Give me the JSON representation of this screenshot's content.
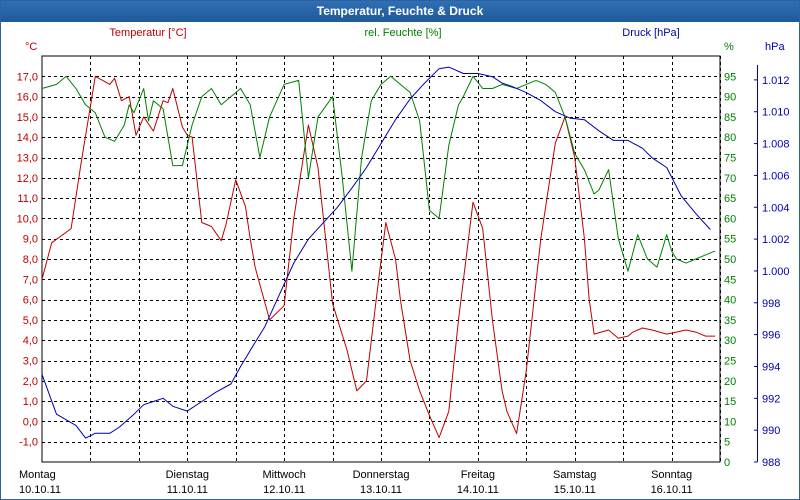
{
  "window": {
    "title": "Temperatur, Feuchte & Druck"
  },
  "chart_data": {
    "type": "line",
    "title": "Temperatur, Feuchte & Druck",
    "colors": {
      "temperature": "#c00000",
      "humidity": "#008000",
      "pressure": "#0000b0",
      "title_bar": "#1f5a9a"
    },
    "x_axis": {
      "range": [
        0,
        7
      ],
      "days": [
        {
          "weekday": "Montag",
          "date": "10.10.11"
        },
        {
          "weekday": "Dienstag",
          "date": "11.10.11"
        },
        {
          "weekday": "Mittwoch",
          "date": "12.10.11"
        },
        {
          "weekday": "Donnerstag",
          "date": "13.10.11"
        },
        {
          "weekday": "Freitag",
          "date": "14.10.11"
        },
        {
          "weekday": "Samstag",
          "date": "15.10.11"
        },
        {
          "weekday": "Sonntag",
          "date": "16.10.11"
        }
      ]
    },
    "left_axis": {
      "label": "Temperatur [°C]",
      "unit": "°C",
      "range": [
        -2,
        18
      ],
      "ticks": [
        "-1,0",
        "0,0",
        "1,0",
        "2,0",
        "3,0",
        "4,0",
        "5,0",
        "6,0",
        "7,0",
        "8,0",
        "9,0",
        "10,0",
        "11,0",
        "12,0",
        "13,0",
        "14,0",
        "15,0",
        "16,0",
        "17,0"
      ]
    },
    "mid_axis": {
      "label": "rel. Feuchte [%]",
      "unit": "%",
      "range": [
        0,
        100
      ],
      "ticks": [
        "0",
        "5",
        "10",
        "15",
        "20",
        "25",
        "30",
        "35",
        "40",
        "45",
        "50",
        "55",
        "60",
        "65",
        "70",
        "75",
        "80",
        "85",
        "90",
        "95"
      ]
    },
    "right_axis": {
      "label": "Druck [hPa]",
      "unit": "hPa",
      "range": [
        988,
        1013.5
      ],
      "ticks": [
        "988",
        "990",
        "992",
        "994",
        "996",
        "998",
        "1.000",
        "1.002",
        "1.004",
        "1.006",
        "1.008",
        "1.010",
        "1.012"
      ]
    },
    "grid": true,
    "series": [
      {
        "name": "Temperatur [°C]",
        "axis": "left",
        "x": [
          0,
          0.1,
          0.3,
          0.4,
          0.55,
          0.7,
          0.75,
          0.82,
          0.9,
          0.97,
          1.05,
          1.15,
          1.25,
          1.3,
          1.35,
          1.45,
          1.5,
          1.55,
          1.65,
          1.75,
          1.85,
          1.9,
          2.0,
          2.1,
          2.15,
          2.2,
          2.35,
          2.5,
          2.6,
          2.75,
          2.85,
          3.0,
          3.15,
          3.25,
          3.35,
          3.45,
          3.55,
          3.65,
          3.7,
          3.75,
          3.8,
          3.9,
          4.0,
          4.1,
          4.2,
          4.3,
          4.45,
          4.55,
          4.65,
          4.75,
          4.8,
          4.9,
          5.0,
          5.15,
          5.3,
          5.4,
          5.5,
          5.6,
          5.65,
          5.7,
          5.85,
          5.95,
          6.05,
          6.1,
          6.2,
          6.3,
          6.45,
          6.55,
          6.65,
          6.75,
          6.8,
          6.85,
          6.95
        ],
        "values": [
          7.0,
          8.8,
          9.5,
          12.6,
          17.0,
          16.6,
          16.9,
          15.8,
          16.0,
          14.1,
          15.0,
          14.3,
          15.8,
          15.7,
          16.4,
          14.5,
          14.1,
          14.0,
          9.8,
          9.6,
          8.9,
          9.7,
          11.9,
          10.6,
          9.0,
          7.6,
          5.0,
          5.7,
          10.0,
          14.6,
          12.5,
          5.8,
          3.5,
          1.5,
          2.0,
          6.0,
          9.8,
          8.0,
          6.0,
          4.5,
          3.0,
          1.5,
          0.3,
          -0.8,
          0.5,
          5.0,
          10.8,
          9.5,
          5.0,
          1.5,
          0.5,
          -0.6,
          2.5,
          9.0,
          13.7,
          15.0,
          13.0,
          9.0,
          6.0,
          4.3,
          4.5,
          4.1,
          4.2,
          4.4,
          4.6,
          4.5,
          4.3,
          4.4,
          4.5,
          4.4,
          4.3,
          4.2,
          4.2
        ]
      },
      {
        "name": "rel. Feuchte [%]",
        "axis": "mid",
        "x": [
          0,
          0.15,
          0.25,
          0.35,
          0.45,
          0.55,
          0.65,
          0.75,
          0.85,
          0.9,
          0.95,
          1.05,
          1.1,
          1.15,
          1.25,
          1.35,
          1.45,
          1.55,
          1.65,
          1.75,
          1.85,
          1.95,
          2.05,
          2.15,
          2.25,
          2.35,
          2.5,
          2.65,
          2.75,
          2.85,
          3.0,
          3.1,
          3.2,
          3.3,
          3.4,
          3.5,
          3.6,
          3.7,
          3.8,
          3.9,
          4.0,
          4.1,
          4.2,
          4.3,
          4.35,
          4.45,
          4.55,
          4.65,
          4.75,
          4.9,
          5.0,
          5.1,
          5.2,
          5.3,
          5.4,
          5.5,
          5.6,
          5.7,
          5.75,
          5.85,
          5.95,
          6.05,
          6.15,
          6.25,
          6.35,
          6.45,
          6.5,
          6.55,
          6.65,
          6.75,
          6.85,
          6.95
        ],
        "values": [
          92,
          93,
          95,
          92,
          88,
          86,
          80,
          79,
          83,
          88,
          86,
          92,
          84,
          89,
          87,
          73,
          73,
          83,
          90,
          92,
          88,
          90,
          92,
          88,
          75,
          85,
          93,
          94,
          70,
          85,
          90,
          70,
          47,
          75,
          89,
          93,
          95,
          93,
          91,
          84,
          62,
          60,
          78,
          88,
          90,
          95,
          92,
          92,
          93,
          92,
          93,
          94,
          93,
          91,
          85,
          76,
          72,
          66,
          67,
          72,
          55,
          47,
          56,
          50,
          48,
          56,
          52,
          50,
          49,
          50,
          51,
          52
        ]
      },
      {
        "name": "Druck [hPa]",
        "axis": "right",
        "x": [
          0,
          0.15,
          0.35,
          0.45,
          0.55,
          0.7,
          0.8,
          0.95,
          1.05,
          1.15,
          1.25,
          1.35,
          1.5,
          1.65,
          1.8,
          1.95,
          2.05,
          2.15,
          2.3,
          2.45,
          2.6,
          2.75,
          2.9,
          3.05,
          3.2,
          3.35,
          3.5,
          3.65,
          3.8,
          3.95,
          4.1,
          4.2,
          4.35,
          4.5,
          4.65,
          4.75,
          4.85,
          5.0,
          5.15,
          5.3,
          5.45,
          5.6,
          5.75,
          5.9,
          6.05,
          6.2,
          6.3,
          6.45,
          6.6,
          6.75,
          6.9
        ],
        "values": [
          993.5,
          991.0,
          990.3,
          989.5,
          989.8,
          989.8,
          990.2,
          991.0,
          991.6,
          991.8,
          992.0,
          991.5,
          991.2,
          991.8,
          992.4,
          992.9,
          994.0,
          995.0,
          996.5,
          998.5,
          1000.5,
          1002.0,
          1003.0,
          1004.0,
          1005.2,
          1006.5,
          1008.0,
          1009.5,
          1010.8,
          1011.8,
          1012.7,
          1012.8,
          1012.4,
          1012.4,
          1012.2,
          1011.8,
          1011.6,
          1011.2,
          1010.7,
          1010.0,
          1009.6,
          1009.5,
          1008.8,
          1008.2,
          1008.2,
          1007.7,
          1007.1,
          1006.5,
          1004.7,
          1003.6,
          1002.6
        ]
      }
    ]
  }
}
